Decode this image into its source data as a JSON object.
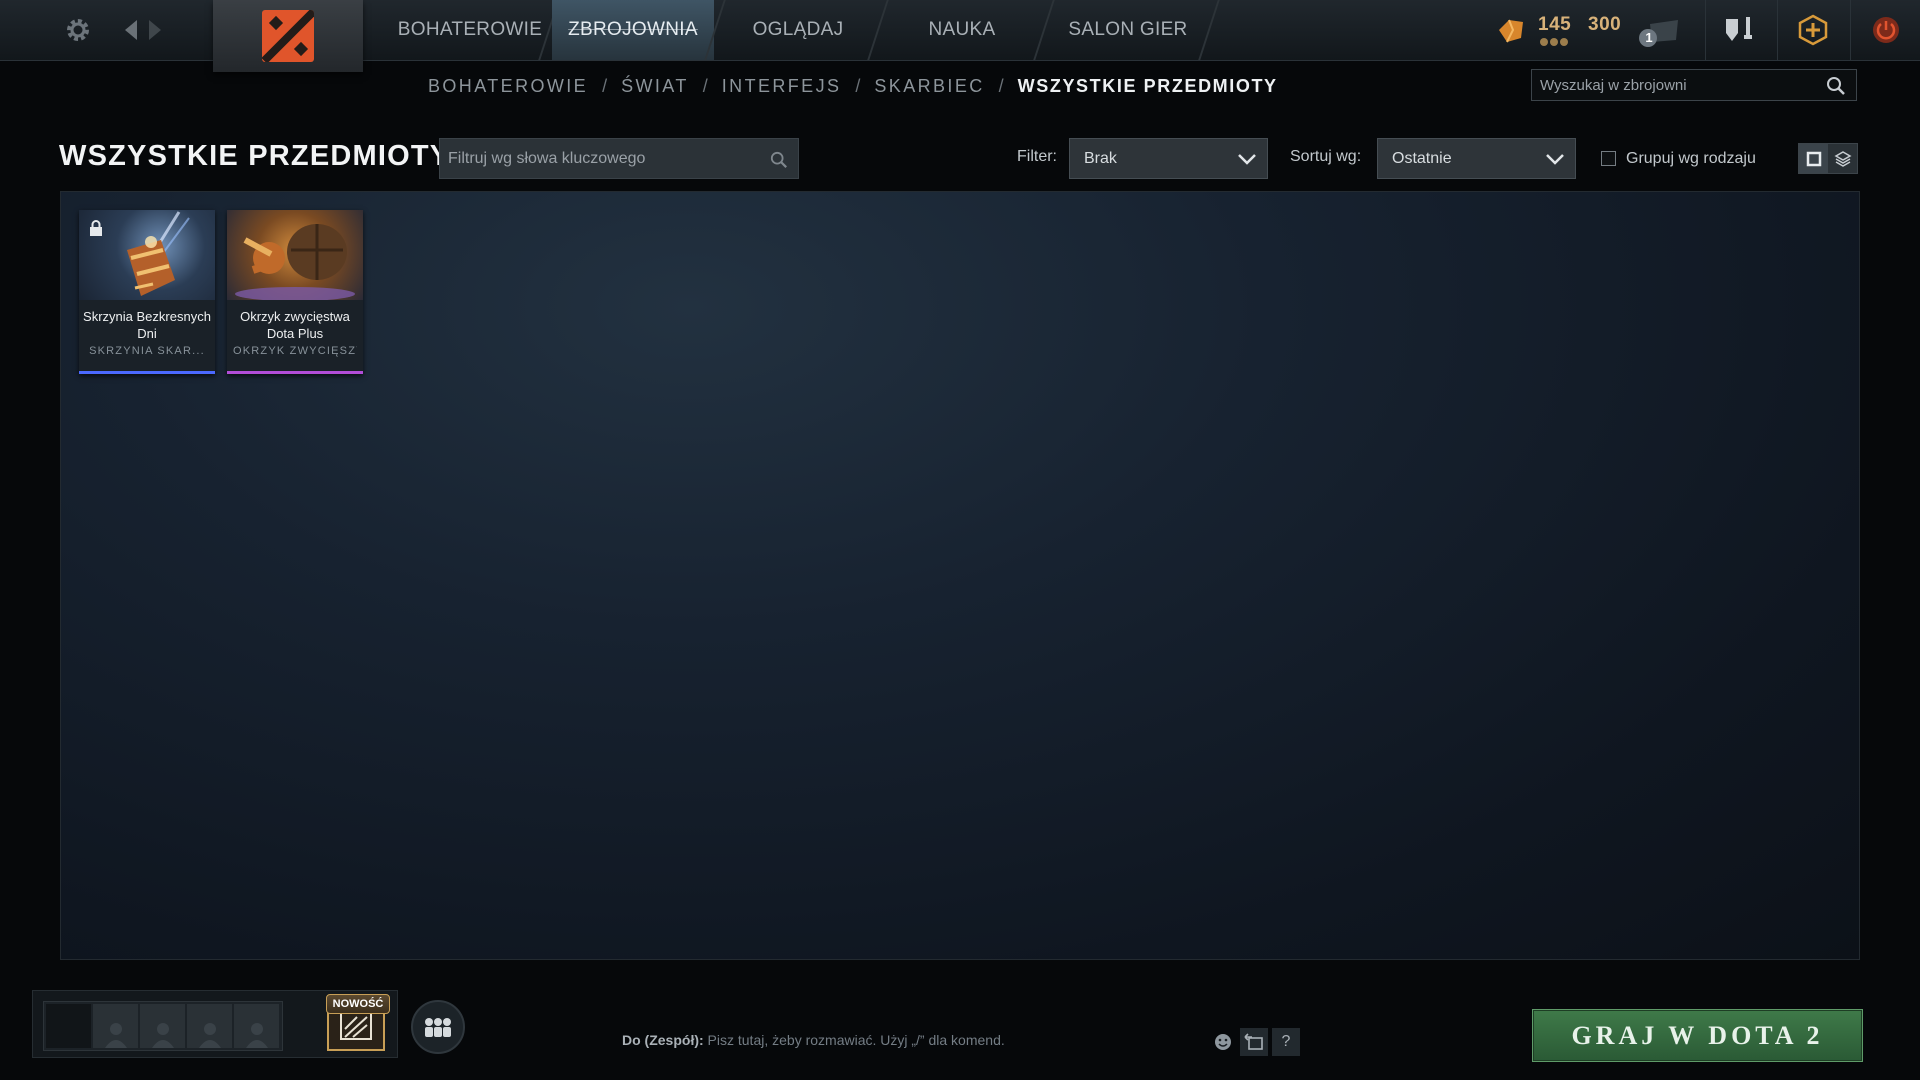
{
  "topnav": {
    "tabs": [
      {
        "label": "BOHATEROWIE"
      },
      {
        "label": "ZBROJOWNIA"
      },
      {
        "label": "OGLĄDAJ"
      },
      {
        "label": "NAUKA"
      },
      {
        "label": "SALON GIER"
      }
    ],
    "active_tab": "ZBROJOWNIA",
    "shards": "145",
    "points": "300",
    "inbox_count": "1"
  },
  "breadcrumb": {
    "items": [
      "BOHATEROWIE",
      "ŚWIAT",
      "INTERFEJS",
      "SKARBIEC"
    ],
    "separator": "/",
    "current": "WSZYSTKIE PRZEDMIOTY"
  },
  "armory_search": {
    "placeholder": "Wyszukaj w zbrojowni"
  },
  "toolbar": {
    "title": "WSZYSTKIE PRZEDMIOTY",
    "keyword_placeholder": "Filtruj wg słowa kluczowego",
    "filter_label": "Filter:",
    "filter_value": "Brak",
    "sort_label": "Sortuj wg:",
    "sort_value": "Ostatnie",
    "group_label": "Grupuj wg rodzaju",
    "group_checked": false
  },
  "items": [
    {
      "name": "Skrzynia Bezkresnych Dni",
      "type": "SKRZYNIA SKAR...",
      "locked": true,
      "rarity_color": "#4b69ff"
    },
    {
      "name": "Okrzyk zwycięstwa Dota Plus",
      "type": "OKRZYK ZWYCIĘSZYS...",
      "locked": false,
      "rarity_color": "#b24dd8"
    }
  ],
  "bottom": {
    "new_badge": "NOWOŚĆ",
    "chat_target": "Do (Zespół):",
    "chat_placeholder": "Pisz tutaj, żeby rozmawiać. Użyj „/” dla komend.",
    "help": "?",
    "play_button": "GRAJ W DOTA 2"
  },
  "colors": {
    "accent_green": "#3f7a49",
    "shards_gold": "#d8b27a",
    "power_red": "#c8442a"
  }
}
